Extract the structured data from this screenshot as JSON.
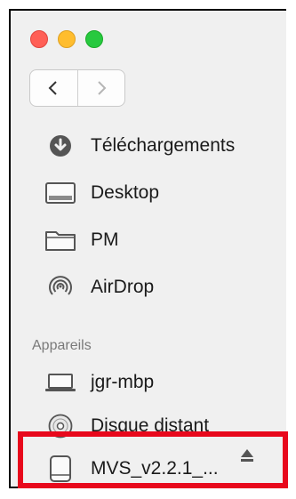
{
  "window": {
    "traffic_lights": [
      {
        "name": "close",
        "color": "#ff5f56"
      },
      {
        "name": "minimize",
        "color": "#ffbd2e"
      },
      {
        "name": "zoom",
        "color": "#27c93f"
      }
    ]
  },
  "toolbar": {
    "back_icon": "chevron-left-icon",
    "forward_icon": "chevron-right-icon"
  },
  "sidebar": {
    "favorites": [
      {
        "label": "Téléchargements",
        "icon": "download-icon"
      },
      {
        "label": "Desktop",
        "icon": "desktop-icon"
      },
      {
        "label": "PM",
        "icon": "folder-icon"
      },
      {
        "label": "AirDrop",
        "icon": "airdrop-icon"
      }
    ],
    "devices_header": "Appareils",
    "devices": [
      {
        "label": "jgr-mbp",
        "icon": "laptop-icon"
      },
      {
        "label": "Disque distant",
        "icon": "disc-icon"
      },
      {
        "label": "MVS_v2.2.1_...",
        "icon": "drive-icon",
        "eject_icon": "eject-icon",
        "highlighted": true
      }
    ]
  },
  "colors": {
    "highlight": "#e8081c",
    "sidebar_bg": "#f0f0f0",
    "section_header": "#7a7a7a"
  }
}
